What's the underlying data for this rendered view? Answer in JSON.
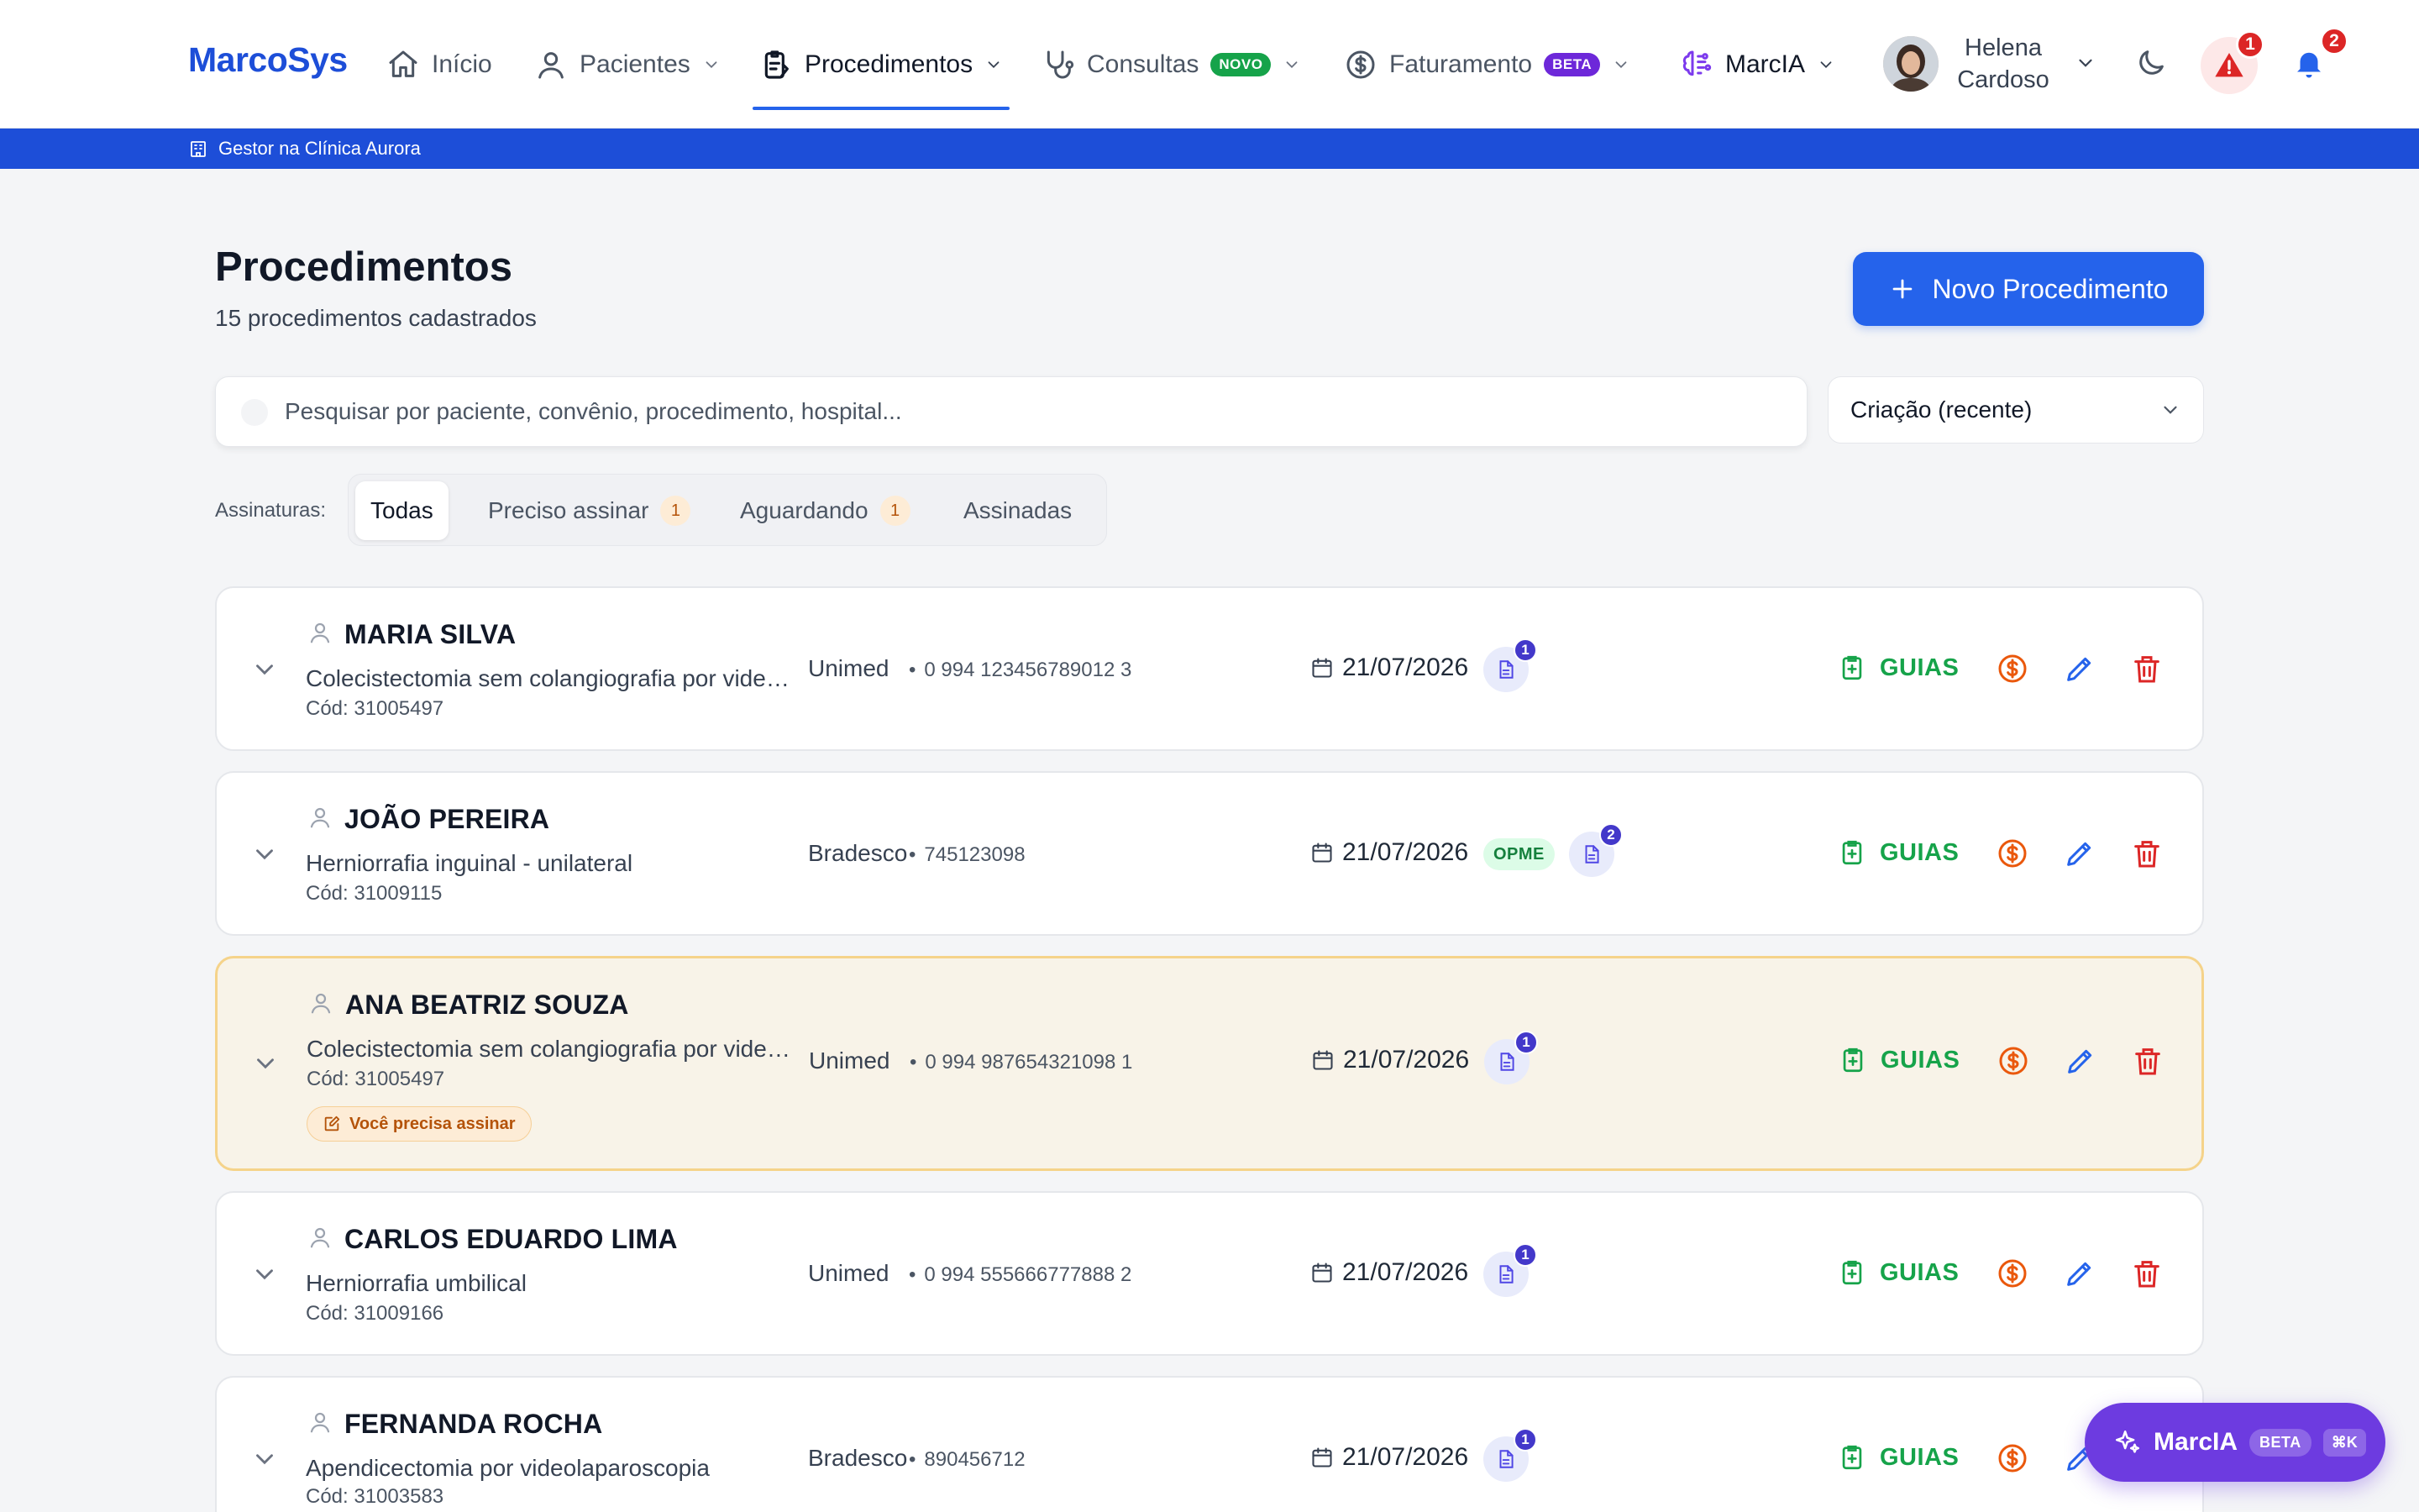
{
  "app": {
    "logo": "MarcoSys"
  },
  "nav": {
    "inicio": "Início",
    "pacientes": "Pacientes",
    "procedimentos": "Procedimentos",
    "consultas": "Consultas",
    "consultas_badge": "NOVO",
    "faturamento": "Faturamento",
    "faturamento_badge": "BETA",
    "marcia": "MarcIA",
    "user_first": "Helena",
    "user_last": "Cardoso",
    "alerts_count": "1",
    "notifications_count": "2"
  },
  "context": {
    "role_label": "Gestor na Clínica Aurora"
  },
  "header": {
    "title": "Procedimentos",
    "subtitle": "15 procedimentos cadastrados",
    "new_button": "Novo Procedimento"
  },
  "search": {
    "placeholder": "Pesquisar por paciente, convênio, procedimento, hospital...",
    "value": ""
  },
  "sort": {
    "selected": "Criação (recente)"
  },
  "filters": {
    "label": "Assinaturas:",
    "tabs": [
      {
        "label": "Todas",
        "count": ""
      },
      {
        "label": "Preciso assinar",
        "count": "1"
      },
      {
        "label": "Aguardando",
        "count": "1"
      },
      {
        "label": "Assinadas",
        "count": ""
      }
    ]
  },
  "colors": {
    "brand": "#1d4ed8",
    "primary": "#2563eb",
    "success": "#16a34a",
    "warning": "#ea580c",
    "danger": "#dc2626",
    "ai": "#6d3be0"
  },
  "rows": [
    {
      "name": "MARIA SILVA",
      "procedure": "Colecistectomia sem colangiografia por videolaparoscopia",
      "code": "Cód: 31005497",
      "insurer": "Unimed",
      "card": "0 994 123456789012 3",
      "date": "21/07/2026",
      "opme": "",
      "docs": "1",
      "sign_tag": "",
      "guias": "GUIAS"
    },
    {
      "name": "JOÃO PEREIRA",
      "procedure": "Herniorrafia inguinal - unilateral",
      "code": "Cód: 31009115",
      "insurer": "Bradesco",
      "card": "745123098",
      "date": "21/07/2026",
      "opme": "OPME",
      "docs": "2",
      "sign_tag": "",
      "guias": "GUIAS"
    },
    {
      "name": "ANA BEATRIZ SOUZA",
      "procedure": "Colecistectomia sem colangiografia por videolaparoscopia",
      "code": "Cód: 31005497",
      "insurer": "Unimed",
      "card": "0 994 987654321098 1",
      "date": "21/07/2026",
      "opme": "",
      "docs": "1",
      "sign_tag": "Você precisa assinar",
      "guias": "GUIAS"
    },
    {
      "name": "CARLOS EDUARDO LIMA",
      "procedure": "Herniorrafia umbilical",
      "code": "Cód: 31009166",
      "insurer": "Unimed",
      "card": "0 994 555666777888 2",
      "date": "21/07/2026",
      "opme": "",
      "docs": "1",
      "sign_tag": "",
      "guias": "GUIAS"
    },
    {
      "name": "FERNANDA ROCHA",
      "procedure": "Apendicectomia por videolaparoscopia",
      "code": "Cód: 31003583",
      "insurer": "Bradesco",
      "card": "890456712",
      "date": "21/07/2026",
      "opme": "",
      "docs": "1",
      "sign_tag": "",
      "guias": "GUIAS"
    }
  ],
  "fab": {
    "label": "MarcIA",
    "badge": "BETA",
    "shortcut": "⌘K"
  }
}
